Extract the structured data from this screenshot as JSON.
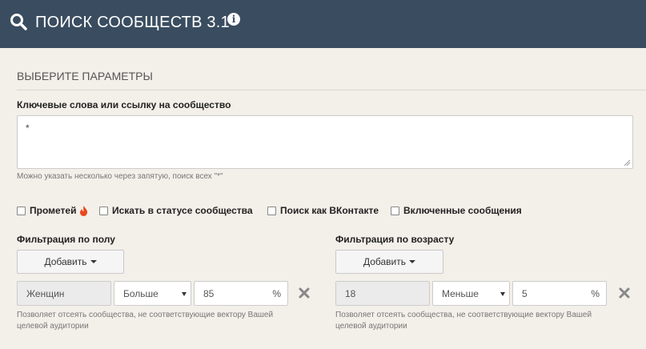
{
  "header": {
    "title": "ПОИСК СООБЩЕСТВ 3.1",
    "search_icon": "search-icon",
    "info_icon": "info-icon",
    "info_glyph": "i"
  },
  "section_title": "ВЫБЕРИТЕ ПАРАМЕТРЫ",
  "keywords": {
    "label": "Ключевые слова или ссылку на сообщество",
    "value": "*",
    "help": "Можно указать несколько через запятую, поиск всех \"*\""
  },
  "checkboxes": [
    {
      "label": "Прометей",
      "checked": false,
      "icon": "fire-icon"
    },
    {
      "label": "Искать в статусе сообщества",
      "checked": false
    },
    {
      "label": "Поиск как ВКонтакте",
      "checked": false
    },
    {
      "label": "Включенные сообщения",
      "checked": false
    }
  ],
  "gender_filter": {
    "label": "Фильтрация по полу",
    "add_button": "Добавить",
    "value": "Женщин",
    "comparison": "Больше",
    "percent": "85",
    "percent_sign": "%",
    "help": "Позволяет отсеять сообщества, не соответствующие вектору Вашей целевой аудитории"
  },
  "age_filter": {
    "label": "Фильтрация по возрасту",
    "add_button": "Добавить",
    "value": "18",
    "comparison": "Меньше",
    "percent": "5",
    "percent_sign": "%",
    "help": "Позволяет отсеять сообщества, не соответствующие вектору Вашей целевой аудитории"
  },
  "colors": {
    "header_bg": "#3a4d60",
    "page_bg": "#f3efe9",
    "fire": "#e8481f",
    "remove_icon": "#888888"
  }
}
